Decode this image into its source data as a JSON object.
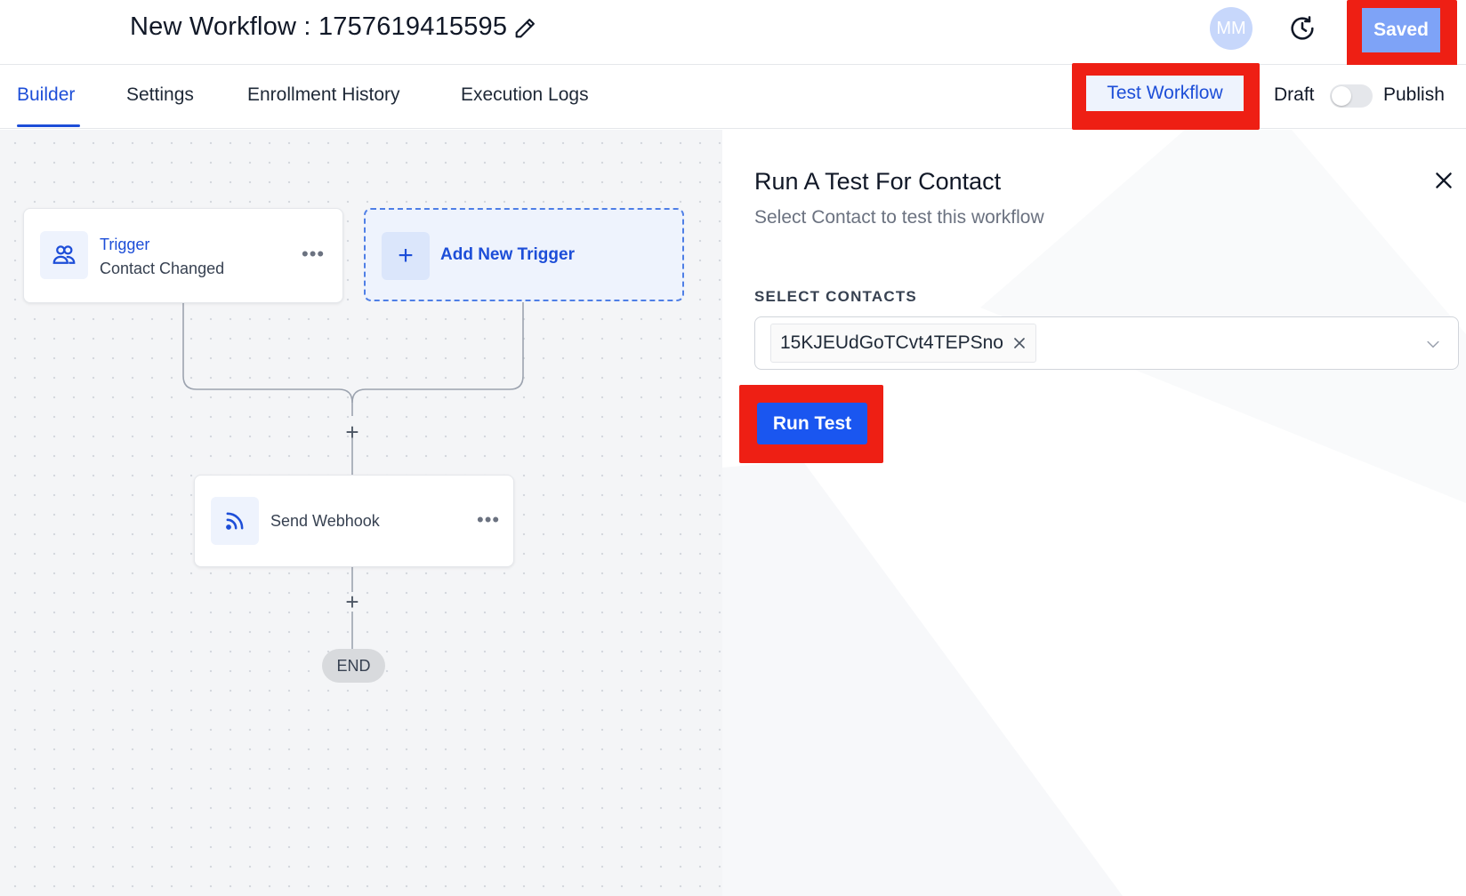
{
  "header": {
    "title": "New Workflow : 1757619415595",
    "avatar_initials": "MM",
    "saved_label": "Saved",
    "icons": [
      "pencil-icon",
      "history-icon"
    ]
  },
  "tabs": {
    "items": [
      {
        "label": "Builder",
        "active": true
      },
      {
        "label": "Settings",
        "active": false
      },
      {
        "label": "Enrollment History",
        "active": false
      },
      {
        "label": "Execution Logs",
        "active": false
      }
    ],
    "test_workflow_label": "Test Workflow",
    "draft_label": "Draft",
    "publish_label": "Publish",
    "published": false
  },
  "canvas": {
    "trigger_node": {
      "title": "Trigger",
      "subtitle": "Contact Changed",
      "menu": "•••",
      "icon": "users-icon"
    },
    "add_trigger_label": "Add New Trigger",
    "action_node": {
      "label": "Send Webhook",
      "menu": "•••",
      "icon": "webhook-icon"
    },
    "plus_symbol": "+",
    "end_label": "END"
  },
  "panel": {
    "title": "Run A Test For Contact",
    "subtitle": "Select Contact to test this workflow",
    "select_label": "SELECT CONTACTS",
    "selected_contact": "15KJEUdGoTCvt4TEPSno",
    "run_button_label": "Run Test"
  },
  "colors": {
    "accent": "#1d4ed8",
    "run_button": "#1a56f0",
    "highlight": "#ee1f14",
    "saved_button": "#7ea3f7"
  }
}
